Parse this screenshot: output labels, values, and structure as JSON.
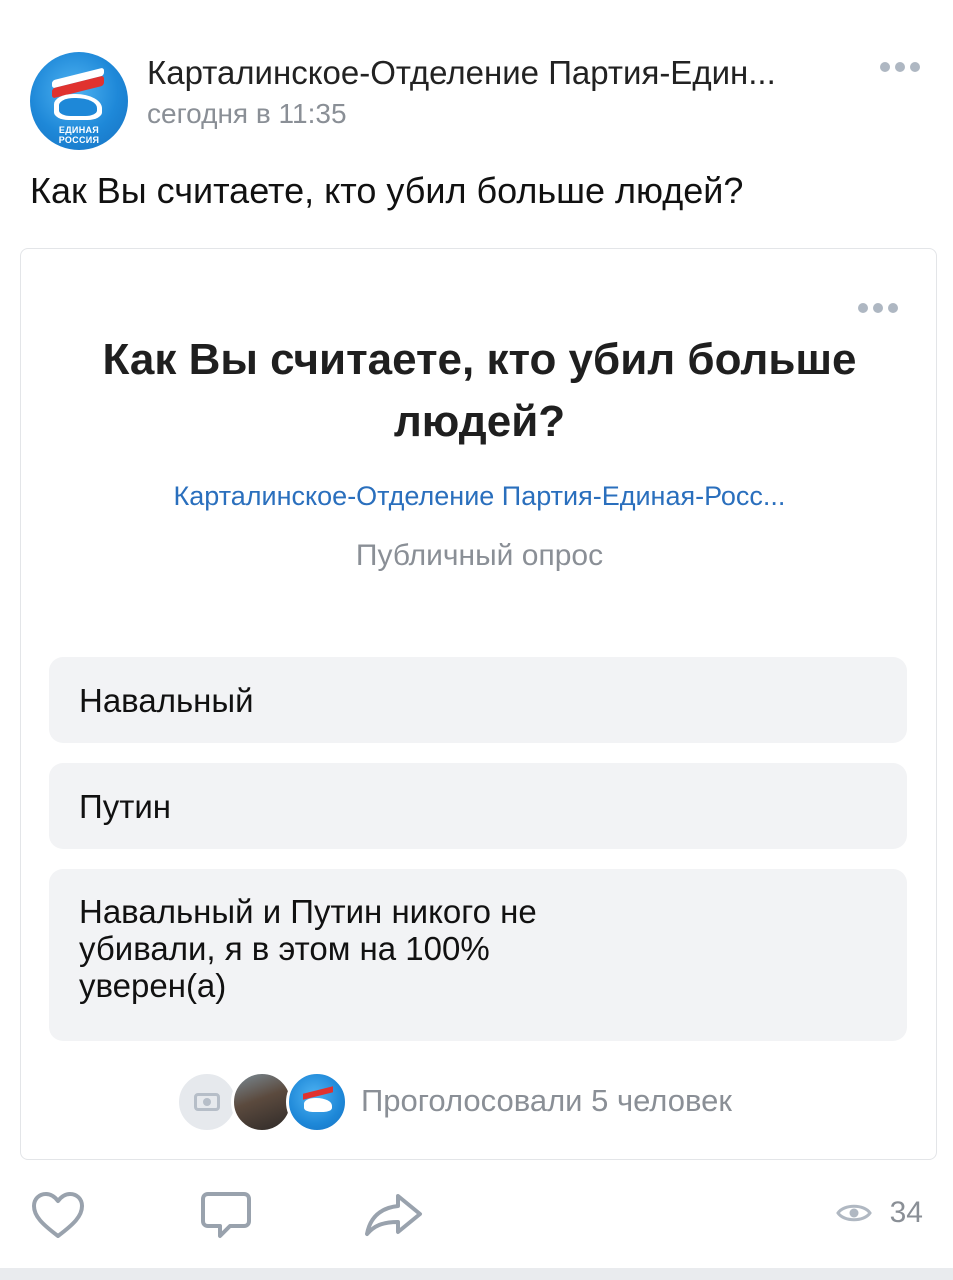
{
  "post": {
    "author": "Карталинское-Отделение Партия-Един...",
    "time": "сегодня в 11:35",
    "text": "Как Вы считаете, кто убил больше людей?",
    "avatar_logo": [
      "ЕДИНАЯ",
      "РОССИЯ"
    ]
  },
  "poll": {
    "title": "Как Вы считаете, кто убил больше людей?",
    "author": "Карталинское-Отделение Партия-Единая-Росс...",
    "type": "Публичный опрос",
    "options": [
      {
        "label": "Навальный"
      },
      {
        "label": "Путин"
      },
      {
        "label": "Навальный и Путин никого не убивали, я в этом на 100% уверен(а)"
      }
    ],
    "voters_text": "Проголосовали 5 человек"
  },
  "actions": {
    "like_icon": "heart-icon",
    "comment_icon": "comment-icon",
    "share_icon": "share-icon",
    "views_icon": "eye-icon",
    "views_count": "34"
  },
  "colors": {
    "link": "#2a6fbd",
    "secondary_text": "#8a8f96",
    "option_bg": "#f2f3f5",
    "icon": "#99a2ad"
  }
}
